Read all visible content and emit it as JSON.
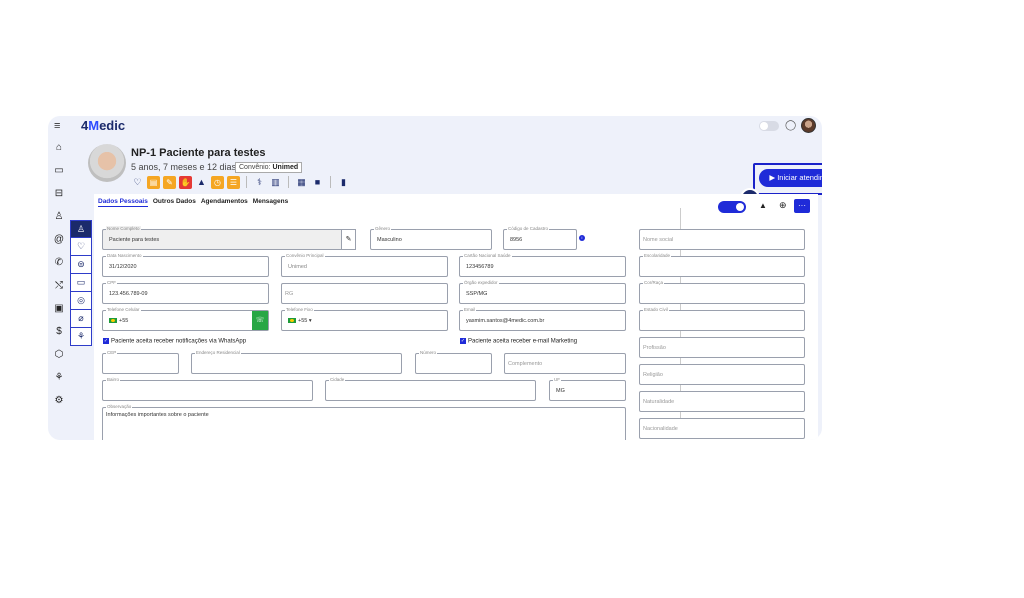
{
  "app": {
    "logo_prefix": "4",
    "logo_m": "M",
    "logo_rest": "edic"
  },
  "icons": {
    "hamburger": "≡",
    "chat": "◯",
    "nav": [
      "⌂",
      "▭",
      "⊟",
      "♙",
      "@",
      "✆",
      "⤭",
      "▣",
      "$",
      "⬡",
      "⚘",
      "⚙"
    ],
    "patient_actions": [
      "♡",
      "▤",
      "✎",
      "✋",
      "▲",
      "◷",
      "☰",
      "⚕",
      "▥",
      "▦",
      "■",
      "▮"
    ],
    "side_tabs": [
      "♙",
      "♡",
      "⊜",
      "▭",
      "◎",
      "⌀",
      "⚘"
    ]
  },
  "patient": {
    "name": "NP-1 Paciente para testes",
    "age": "5 anos, 7 meses e 12 dias",
    "convenio_label": "Convênio:",
    "convenio_value": "Unimed"
  },
  "actions": {
    "start": "▶ Iniciar atendimento",
    "step": "3"
  },
  "tabs": [
    "Dados Pessoais",
    "Outros Dados",
    "Agendamentos",
    "Mensagens"
  ],
  "toolbar": {
    "more": "···",
    "warn": "▲",
    "globe": "⊕"
  },
  "form": {
    "nome_label": "Nome Completo",
    "nome": "Paciente para testes",
    "genero_label": "Gênero",
    "genero": "Masculino",
    "codigo_label": "Código de Cadastro",
    "codigo": "8956",
    "nasc_label": "Data Nascimento",
    "nasc": "31/12/2020",
    "conv_label": "Convênio Principal",
    "conv": "Unimed",
    "sus_label": "Cartão Nacional Saúde",
    "sus": "123456789",
    "cpf_label": "CPF",
    "cpf": "123.456.789-09",
    "rg_ph": "RG",
    "orgao_label": "Órgão expedidor",
    "orgao": "SSP/MG",
    "cel_label": "Telefone Celular",
    "cel": "+55",
    "fixo_label": "Telefone Fixo",
    "fixo": "+55 ▾",
    "email_label": "Email",
    "email": "yasmim.santos@4medic.com.br",
    "chk_whatsapp": "Paciente aceita receber notificações via WhatsApp",
    "chk_email": "Paciente aceita receber e-mail Marketing",
    "cep_label": "CEP",
    "endereco_label": "Endereço Residencial",
    "numero_label": "Número",
    "complemento_ph": "Complemento",
    "bairro_label": "Bairro",
    "cidade_label": "Cidade",
    "uf_label": "UF",
    "uf": "MG",
    "obs_label": "Observação",
    "obs": "Informações importantes sobre o paciente",
    "nome_social_ph": "Nome social",
    "escolaridade_label": "Escolaridade",
    "cor_label": "Cor/Raça",
    "estado_civil_label": "Estado Civil",
    "profissao_ph": "Profissão",
    "religiao_ph": "Religião",
    "naturalidade_ph": "Naturalidade",
    "nacionalidade_ph": "Nacionalidade"
  }
}
